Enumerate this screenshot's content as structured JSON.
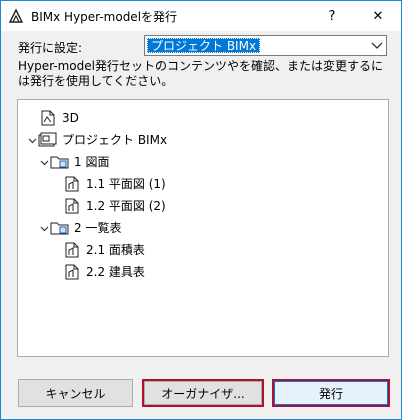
{
  "window": {
    "title": "BIMx Hyper-modelを発行",
    "help_glyph": "?",
    "close_glyph": "✕"
  },
  "settings": {
    "label": "発行に設定:",
    "selected_value": "プロジェクト BIMx"
  },
  "description": "Hyper-model発行セットのコンテンツやを確認、または変更するには発行を使用してください。",
  "tree": {
    "items": [
      {
        "label": "3D",
        "icon": "3d-view-icon",
        "expanded": null
      },
      {
        "label": "プロジェクト BIMx",
        "icon": "project-book-icon",
        "expanded": true
      },
      {
        "label": "1 図面",
        "icon": "folder-icon",
        "expanded": true
      },
      {
        "label": "1.1 平面図 (1)",
        "icon": "layout-icon",
        "expanded": null
      },
      {
        "label": "1.2 平面図 (2)",
        "icon": "layout-icon",
        "expanded": null
      },
      {
        "label": "2 一覧表",
        "icon": "folder-icon",
        "expanded": true
      },
      {
        "label": "2.1 面積表",
        "icon": "layout-icon",
        "expanded": null
      },
      {
        "label": "2.2 建具表",
        "icon": "layout-icon",
        "expanded": null
      }
    ]
  },
  "buttons": {
    "cancel": "キャンセル",
    "organize": "オーガナイザ...",
    "publish": "発行"
  },
  "colors": {
    "window_border": "#1a8ad4",
    "selection": "#0078d7",
    "highlight_border": "#b0102a",
    "dialog_bg": "#f0f0f0"
  }
}
